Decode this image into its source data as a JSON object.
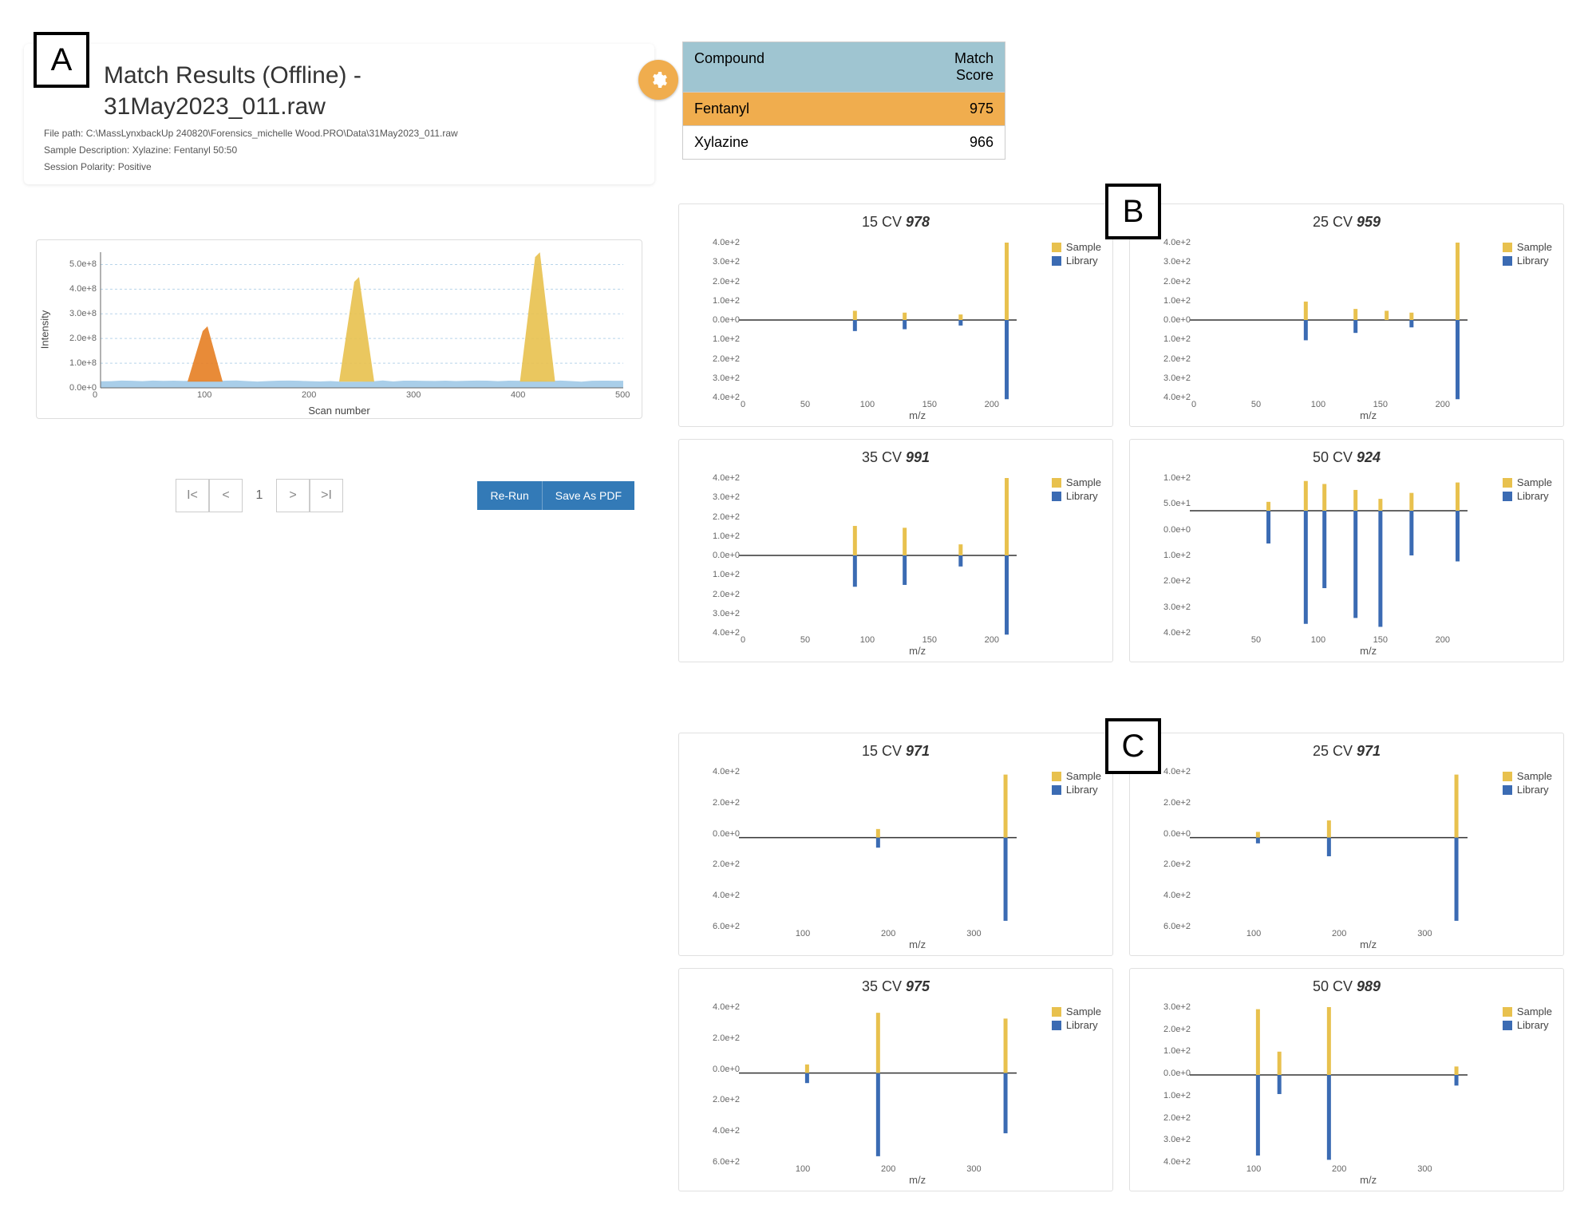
{
  "panelLabels": {
    "A": "A",
    "B": "B",
    "C": "C"
  },
  "header": {
    "title_l1": "Match Results (Offline) -",
    "title_l2": "31May2023_011.raw",
    "filepath": "File path: C:\\MassLynxbackUp 240820\\Forensics_michelle Wood.PRO\\Data\\31May2023_011.raw",
    "sample_desc": "Sample Description: Xylazine: Fentanyl 50:50",
    "polarity": "Session Polarity: Positive"
  },
  "results_table": {
    "col_compound": "Compound",
    "col_score": "Match Score",
    "rows": [
      {
        "name": "Fentanyl",
        "score": "975",
        "selected": true
      },
      {
        "name": "Xylazine",
        "score": "966",
        "selected": false
      }
    ]
  },
  "pager": {
    "page": "1"
  },
  "buttons": {
    "rerun": "Re-Run",
    "save_pdf": "Save As PDF"
  },
  "chrom": {
    "ylabel": "Intensity",
    "xlabel": "Scan number"
  },
  "legend": {
    "sample": "Sample",
    "library": "Library"
  },
  "spec_xlabel": "m/z",
  "chart_data": {
    "chromatogram": {
      "type": "area",
      "xlabel": "Scan number",
      "ylabel": "Intensity",
      "xlim": [
        0,
        500
      ],
      "ylim": [
        0,
        550000000.0
      ],
      "yticks": [
        "0.0e+0",
        "1.0e+8",
        "2.0e+8",
        "3.0e+8",
        "4.0e+8",
        "5.0e+8"
      ],
      "xticks": [
        0,
        100,
        200,
        300,
        400,
        500
      ],
      "peaks": [
        {
          "scan": 100,
          "intensity": 230000000.0,
          "color": "#e67e22",
          "label": "peak1"
        },
        {
          "scan": 245,
          "intensity": 430000000.0,
          "color": "#e8c14e",
          "label": "peak2"
        },
        {
          "scan": 418,
          "intensity": 530000000.0,
          "color": "#e8c14e",
          "label": "peak3"
        }
      ],
      "baseline_color": "#6faedb"
    },
    "spectra_B": [
      {
        "cv": 15,
        "score": 978,
        "xlim": [
          0,
          220
        ],
        "xticks": [
          0,
          50,
          100,
          150,
          200
        ],
        "yticks": [
          "4.0e+2",
          "3.0e+2",
          "2.0e+2",
          "1.0e+2",
          "0.0e+0",
          "1.0e+2",
          "2.0e+2",
          "3.0e+2",
          "4.0e+2"
        ],
        "sample": [
          {
            "mz": 90,
            "i": 50
          },
          {
            "mz": 130,
            "i": 40
          },
          {
            "mz": 175,
            "i": 30
          },
          {
            "mz": 212,
            "i": 420
          }
        ],
        "library": [
          {
            "mz": 90,
            "i": 60
          },
          {
            "mz": 130,
            "i": 50
          },
          {
            "mz": 175,
            "i": 30
          },
          {
            "mz": 212,
            "i": 430
          }
        ]
      },
      {
        "cv": 25,
        "score": 959,
        "xlim": [
          0,
          220
        ],
        "xticks": [
          0,
          50,
          100,
          150,
          200
        ],
        "yticks": [
          "4.0e+2",
          "3.0e+2",
          "2.0e+2",
          "1.0e+2",
          "0.0e+0",
          "1.0e+2",
          "2.0e+2",
          "3.0e+2",
          "4.0e+2"
        ],
        "sample": [
          {
            "mz": 90,
            "i": 100
          },
          {
            "mz": 130,
            "i": 60
          },
          {
            "mz": 155,
            "i": 50
          },
          {
            "mz": 175,
            "i": 40
          },
          {
            "mz": 212,
            "i": 420
          }
        ],
        "library": [
          {
            "mz": 90,
            "i": 110
          },
          {
            "mz": 130,
            "i": 70
          },
          {
            "mz": 175,
            "i": 40
          },
          {
            "mz": 212,
            "i": 430
          }
        ]
      },
      {
        "cv": 35,
        "score": 991,
        "xlim": [
          0,
          220
        ],
        "xticks": [
          0,
          50,
          100,
          150,
          200
        ],
        "yticks": [
          "4.0e+2",
          "3.0e+2",
          "2.0e+2",
          "1.0e+2",
          "0.0e+0",
          "1.0e+2",
          "2.0e+2",
          "3.0e+2",
          "4.0e+2"
        ],
        "sample": [
          {
            "mz": 90,
            "i": 160
          },
          {
            "mz": 130,
            "i": 150
          },
          {
            "mz": 175,
            "i": 60
          },
          {
            "mz": 212,
            "i": 420
          }
        ],
        "library": [
          {
            "mz": 90,
            "i": 170
          },
          {
            "mz": 130,
            "i": 160
          },
          {
            "mz": 175,
            "i": 60
          },
          {
            "mz": 212,
            "i": 430
          }
        ]
      },
      {
        "cv": 50,
        "score": 924,
        "xlim": [
          0,
          220
        ],
        "xticks": [
          50,
          100,
          150,
          200
        ],
        "yticks": [
          "1.0e+2",
          "5.0e+1",
          "0.0e+0",
          "1.0e+2",
          "2.0e+2",
          "3.0e+2",
          "4.0e+2"
        ],
        "sample": [
          {
            "mz": 60,
            "i": 30
          },
          {
            "mz": 90,
            "i": 100
          },
          {
            "mz": 105,
            "i": 90
          },
          {
            "mz": 130,
            "i": 70
          },
          {
            "mz": 150,
            "i": 40
          },
          {
            "mz": 175,
            "i": 60
          },
          {
            "mz": 212,
            "i": 95
          }
        ],
        "library": [
          {
            "mz": 60,
            "i": 110
          },
          {
            "mz": 90,
            "i": 380
          },
          {
            "mz": 105,
            "i": 260
          },
          {
            "mz": 130,
            "i": 360
          },
          {
            "mz": 150,
            "i": 390
          },
          {
            "mz": 175,
            "i": 150
          },
          {
            "mz": 212,
            "i": 170
          }
        ],
        "ylim_top": 110,
        "ylim_bot": 410
      }
    ],
    "spectra_C": [
      {
        "cv": 15,
        "score": 971,
        "xlim": [
          30,
          350
        ],
        "xticks": [
          100,
          200,
          300
        ],
        "yticks": [
          "4.0e+2",
          "2.0e+2",
          "0.0e+0",
          "2.0e+2",
          "4.0e+2",
          "6.0e+2"
        ],
        "sample": [
          {
            "mz": 188,
            "i": 60
          },
          {
            "mz": 337,
            "i": 440
          }
        ],
        "library": [
          {
            "mz": 188,
            "i": 70
          },
          {
            "mz": 337,
            "i": 580
          }
        ],
        "ylim_top": 460,
        "ylim_bot": 620
      },
      {
        "cv": 25,
        "score": 971,
        "xlim": [
          30,
          350
        ],
        "xticks": [
          100,
          200,
          300
        ],
        "yticks": [
          "4.0e+2",
          "2.0e+2",
          "0.0e+0",
          "2.0e+2",
          "4.0e+2",
          "6.0e+2"
        ],
        "sample": [
          {
            "mz": 105,
            "i": 40
          },
          {
            "mz": 188,
            "i": 120
          },
          {
            "mz": 337,
            "i": 440
          }
        ],
        "library": [
          {
            "mz": 105,
            "i": 40
          },
          {
            "mz": 188,
            "i": 130
          },
          {
            "mz": 337,
            "i": 580
          }
        ],
        "ylim_top": 460,
        "ylim_bot": 620
      },
      {
        "cv": 35,
        "score": 975,
        "xlim": [
          30,
          350
        ],
        "xticks": [
          100,
          200,
          300
        ],
        "yticks": [
          "4.0e+2",
          "2.0e+2",
          "0.0e+0",
          "2.0e+2",
          "4.0e+2",
          "6.0e+2"
        ],
        "sample": [
          {
            "mz": 105,
            "i": 60
          },
          {
            "mz": 188,
            "i": 420
          },
          {
            "mz": 337,
            "i": 380
          }
        ],
        "library": [
          {
            "mz": 105,
            "i": 70
          },
          {
            "mz": 188,
            "i": 580
          },
          {
            "mz": 337,
            "i": 420
          }
        ],
        "ylim_top": 460,
        "ylim_bot": 620
      },
      {
        "cv": 50,
        "score": 989,
        "xlim": [
          30,
          350
        ],
        "xticks": [
          100,
          200,
          300
        ],
        "yticks": [
          "3.0e+2",
          "2.0e+2",
          "1.0e+2",
          "0.0e+0",
          "1.0e+2",
          "2.0e+2",
          "3.0e+2",
          "4.0e+2"
        ],
        "sample": [
          {
            "mz": 105,
            "i": 310
          },
          {
            "mz": 130,
            "i": 110
          },
          {
            "mz": 188,
            "i": 320
          },
          {
            "mz": 337,
            "i": 40
          }
        ],
        "library": [
          {
            "mz": 105,
            "i": 380
          },
          {
            "mz": 130,
            "i": 90
          },
          {
            "mz": 188,
            "i": 400
          },
          {
            "mz": 337,
            "i": 50
          }
        ],
        "ylim_top": 320,
        "ylim_bot": 410
      }
    ]
  }
}
